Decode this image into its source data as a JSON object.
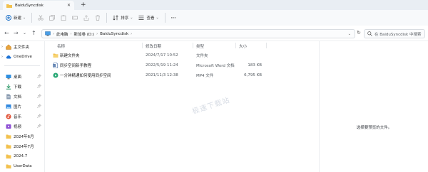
{
  "window": {
    "tab_title": "BaiduSyncdisk",
    "new_tab": "+"
  },
  "toolbar": {
    "new_label": "新建",
    "sort_label": "排序",
    "view_label": "查看",
    "more_label": "···"
  },
  "address": {
    "crumbs": [
      "此电脑",
      "新加卷 (D:)",
      "BaiduSyncdisk"
    ],
    "search_placeholder": "在 BaiduSyncdisk 中搜索"
  },
  "sidebar": {
    "items": [
      {
        "label": "主文件夹",
        "icon": "home-icon",
        "pinned": false
      },
      {
        "label": "OneDrive",
        "icon": "cloud-icon",
        "pinned": false
      },
      {
        "label": "桌面",
        "icon": "desktop-icon",
        "pinned": true
      },
      {
        "label": "下载",
        "icon": "download-icon",
        "pinned": true
      },
      {
        "label": "文档",
        "icon": "document-icon",
        "pinned": true
      },
      {
        "label": "图片",
        "icon": "picture-icon",
        "pinned": true
      },
      {
        "label": "音乐",
        "icon": "music-icon",
        "pinned": true
      },
      {
        "label": "视频",
        "icon": "video-icon",
        "pinned": true
      },
      {
        "label": "2024年6月",
        "icon": "folder-icon",
        "pinned": false
      },
      {
        "label": "2024年7月",
        "icon": "folder-icon",
        "pinned": false
      },
      {
        "label": "2024.7",
        "icon": "folder-icon",
        "pinned": false
      },
      {
        "label": "UserData",
        "icon": "folder-icon",
        "pinned": false
      }
    ]
  },
  "file_list": {
    "headers": {
      "name": "名称",
      "modified": "修改日期",
      "type": "类型",
      "size": "大小"
    },
    "rows": [
      {
        "name": "新建文件夹",
        "modified": "2024/7/17 10:52",
        "type": "文件夹",
        "size": "",
        "icon": "folder-icon"
      },
      {
        "name": "同步空间新手教程",
        "modified": "2022/5/19 11:24",
        "type": "Microsoft Word 文档",
        "size": "183 KB",
        "icon": "word-document-icon"
      },
      {
        "name": "一分钟精通如何使用同步空间",
        "modified": "2021/11/3 12:38",
        "type": "MP4 文件",
        "size": "6,795 KB",
        "icon": "video-file-icon"
      }
    ]
  },
  "preview": {
    "message": "选择要预览的文件。"
  },
  "watermark": "极速下载站",
  "colors": {
    "folder": "#f2c14e",
    "accent": "#0a64c2",
    "titlebar_bg": "#e9eef3"
  }
}
